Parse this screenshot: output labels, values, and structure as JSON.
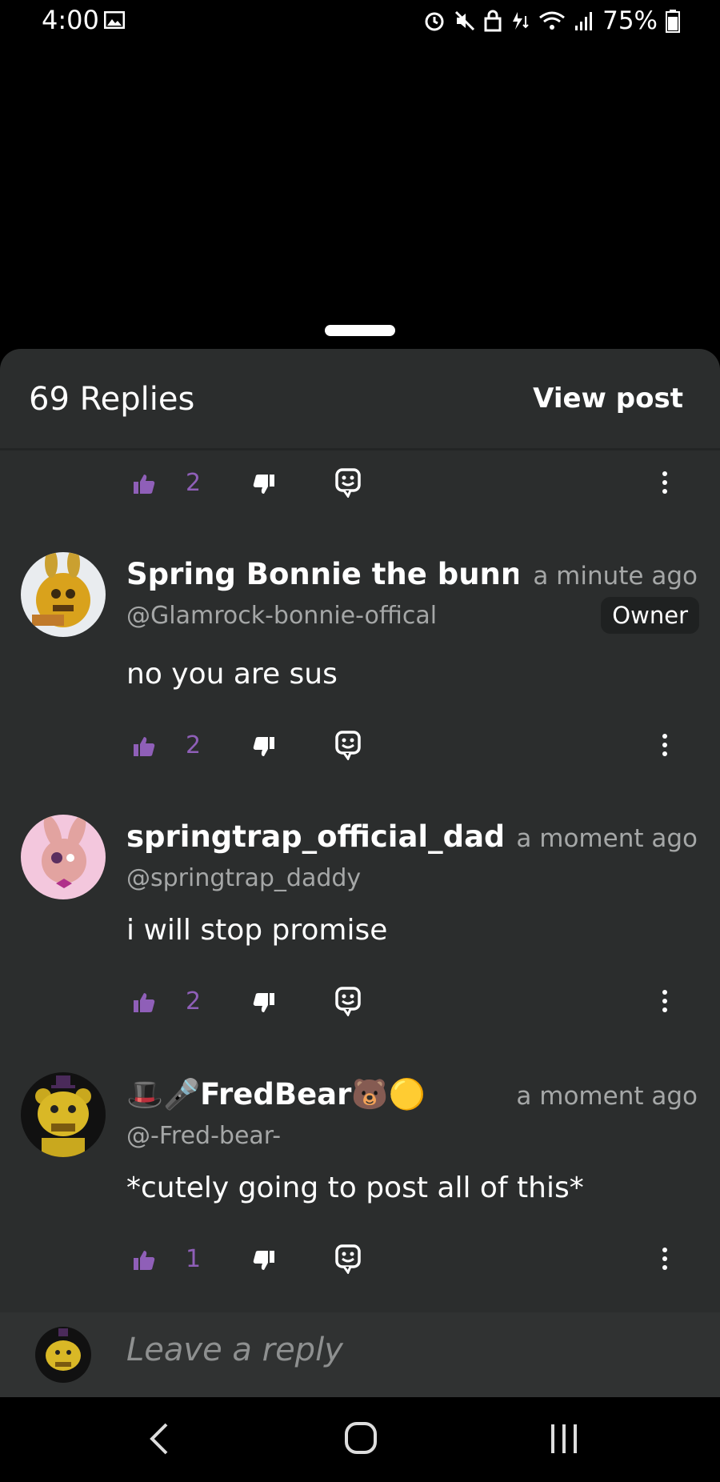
{
  "status_bar": {
    "time": "4:00",
    "battery": "75%",
    "icons": [
      "image-icon",
      "alarm-icon",
      "mute-icon",
      "lock-icon",
      "data-icon",
      "wifi-icon",
      "signal-icon",
      "battery-icon"
    ]
  },
  "header": {
    "replies_count": "69 Replies",
    "view_post": "View post"
  },
  "colors": {
    "accent": "#8f5fb8",
    "sheet": "#2b2d2d",
    "muted": "#a5a7a7"
  },
  "top_actions": {
    "likes": "2"
  },
  "comments": [
    {
      "username": "Spring Bonnie the bunny",
      "handle": "@Glamrock-bonnie-offical",
      "time": "a minute ago",
      "badge": "Owner",
      "text": "no you are sus",
      "likes": "2"
    },
    {
      "username": "springtrap_official_daddy",
      "handle": "@springtrap_daddy",
      "time": "a moment ago",
      "text": "i will stop promise",
      "likes": "2"
    },
    {
      "username": "🎩🎤FredBear🐻🟡",
      "handle": "@-Fred-bear-",
      "time": "a moment ago",
      "text": "*cutely going to post all of this*",
      "likes": "1"
    }
  ],
  "reply_bar": {
    "placeholder": "Leave a reply"
  }
}
